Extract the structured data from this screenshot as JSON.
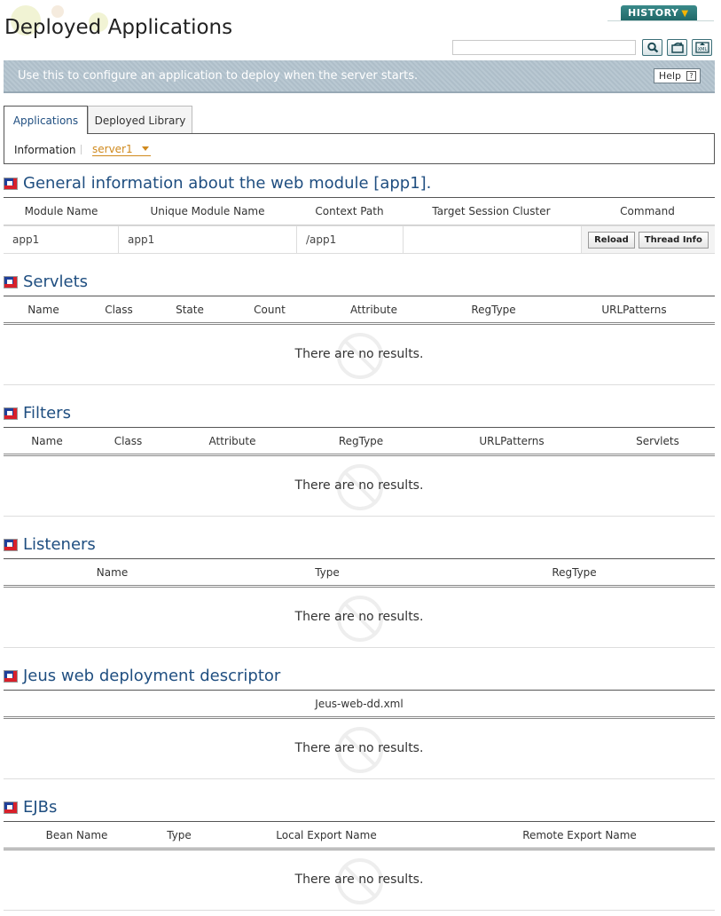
{
  "header": {
    "title": "Deployed Applications",
    "history_label": "HISTORY",
    "search": {
      "value": "",
      "placeholder": ""
    }
  },
  "banner": {
    "text": "Use this to configure an application to deploy when the server starts.",
    "help_label": "Help"
  },
  "tabs": [
    {
      "label": "Applications",
      "active": true
    },
    {
      "label": "Deployed Library",
      "active": false
    }
  ],
  "info_bar": {
    "label": "Information",
    "server": "server1"
  },
  "sections": {
    "general": {
      "title": "General information about the web module [app1].",
      "columns": [
        "Module Name",
        "Unique Module Name",
        "Context Path",
        "Target Session Cluster",
        "Command"
      ],
      "row": [
        "app1",
        "app1",
        "/app1",
        ""
      ],
      "commands": [
        "Reload",
        "Thread Info"
      ]
    },
    "servlets": {
      "title": "Servlets",
      "columns": [
        "Name",
        "Class",
        "State",
        "Count",
        "Attribute",
        "RegType",
        "URLPatterns"
      ],
      "empty": "There are no results."
    },
    "filters": {
      "title": "Filters",
      "columns": [
        "Name",
        "Class",
        "Attribute",
        "RegType",
        "URLPatterns",
        "Servlets"
      ],
      "empty": "There are no results."
    },
    "listeners": {
      "title": "Listeners",
      "columns": [
        "Name",
        "Type",
        "RegType"
      ],
      "empty": "There are no results."
    },
    "jeus_dd": {
      "title": "Jeus web deployment descriptor",
      "columns": [
        "Jeus-web-dd.xml"
      ],
      "empty": "There are no results."
    },
    "ejbs": {
      "title": "EJBs",
      "columns": [
        "Bean Name",
        "Type",
        "Local Export Name",
        "Remote Export Name"
      ],
      "empty": "There are no results."
    }
  },
  "colors": {
    "title_blue": "#1f4e80",
    "server_orange": "#d08a1e",
    "history_teal": "#2a7a7a"
  }
}
